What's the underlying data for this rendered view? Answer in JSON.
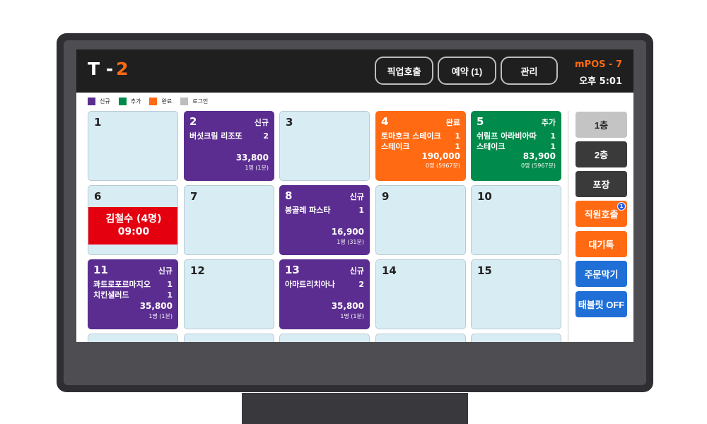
{
  "header": {
    "title_prefix": "T -",
    "title_number": "2",
    "buttons": [
      "픽업호출",
      "예약 (1)",
      "관리"
    ],
    "device": "mPOS - 7",
    "time": "오후 5:01"
  },
  "legend": [
    {
      "label": "신규",
      "color": "#5b2d90"
    },
    {
      "label": "추가",
      "color": "#008a4b"
    },
    {
      "label": "완료",
      "color": "#ff6a13"
    },
    {
      "label": "로그인",
      "color": "#bdbdbd"
    }
  ],
  "colors": {
    "new": "#5b2d90",
    "added": "#008a4b",
    "done": "#ff6a13",
    "empty": "#d8ecf4",
    "reservation": "#e4000f"
  },
  "tables": [
    {
      "no": "1"
    },
    {
      "no": "2",
      "status": "신규",
      "items": [
        {
          "name": "버섯크림 리조또",
          "qty": "2"
        }
      ],
      "total": "33,800",
      "guests": "1명 (1분)"
    },
    {
      "no": "3"
    },
    {
      "no": "4",
      "status": "완료",
      "items": [
        {
          "name": "토마호크 스테이크",
          "qty": "1"
        },
        {
          "name": "스테이크",
          "qty": "1"
        }
      ],
      "total": "190,000",
      "guests": "0명 (5967분)"
    },
    {
      "no": "5",
      "status": "추가",
      "items": [
        {
          "name": "쉬림프 아라비아따",
          "qty": "1"
        },
        {
          "name": "스테이크",
          "qty": "1"
        }
      ],
      "total": "83,900",
      "guests": "0명 (5967분)"
    },
    {
      "no": "6",
      "reservation_name": "김철수 (4명)",
      "reservation_time": "09:00"
    },
    {
      "no": "7"
    },
    {
      "no": "8",
      "status": "신규",
      "items": [
        {
          "name": "봉골레 파스타",
          "qty": "1"
        }
      ],
      "total": "16,900",
      "guests": "1명 (31분)"
    },
    {
      "no": "9"
    },
    {
      "no": "10"
    },
    {
      "no": "11",
      "status": "신규",
      "items": [
        {
          "name": "콰트로포르마지오",
          "qty": "1"
        },
        {
          "name": "치킨샐러드",
          "qty": "1"
        }
      ],
      "total": "35,800",
      "guests": "1명 (1분)"
    },
    {
      "no": "12"
    },
    {
      "no": "13",
      "status": "신규",
      "items": [
        {
          "name": "아마트리치아나",
          "qty": "2"
        }
      ],
      "total": "35,800",
      "guests": "1명 (1분)"
    },
    {
      "no": "14"
    },
    {
      "no": "15"
    }
  ],
  "side_buttons": [
    {
      "label": "1층",
      "style": "selected"
    },
    {
      "label": "2층",
      "style": "dark"
    },
    {
      "label": "포장",
      "style": "dark"
    },
    {
      "label": "직원호출",
      "style": "orange",
      "badge": "1"
    },
    {
      "label": "대기톡",
      "style": "orange"
    },
    {
      "label": "주문막기",
      "style": "blue"
    },
    {
      "label": "태블릿 OFF",
      "style": "blue"
    }
  ]
}
